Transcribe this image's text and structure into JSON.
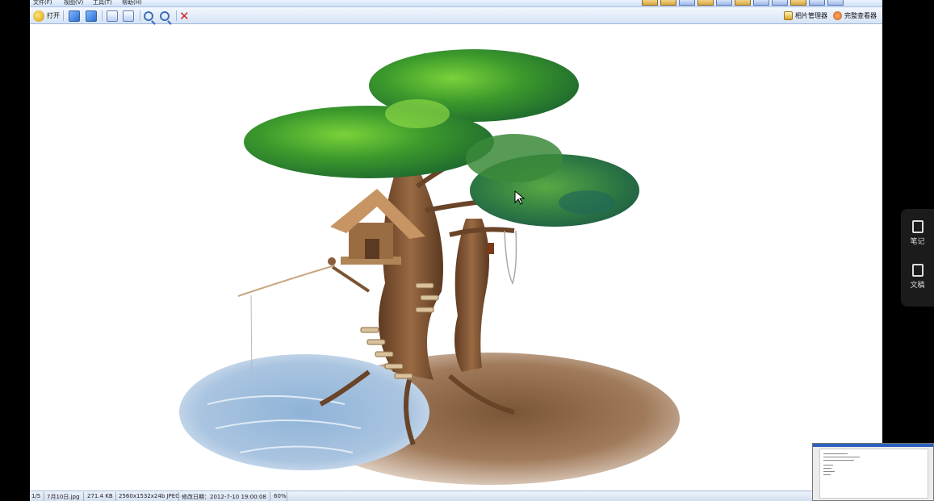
{
  "menubar": {
    "items": [
      "文件(F)",
      "视图(V)",
      "工具(T)",
      "帮助(H)"
    ]
  },
  "toolbar": {
    "open_label": "打开",
    "album_manager": "相片管理器",
    "full_viewer": "完整查看器"
  },
  "statusbar": {
    "page": "1/5",
    "filename": "7月10日.jpg",
    "filesize": "271.4 KB",
    "dimensions": "2560x1532x24b JPEG",
    "modified": "修改日期：2012-7-10 19:00:08",
    "zoom": "60%"
  },
  "side_panel": {
    "notes_label": "笔记",
    "draft_label": "文稿"
  },
  "colors": {
    "toolbar_bg": "#dbe7f7",
    "side_panel_bg": "#1b1b1b"
  }
}
